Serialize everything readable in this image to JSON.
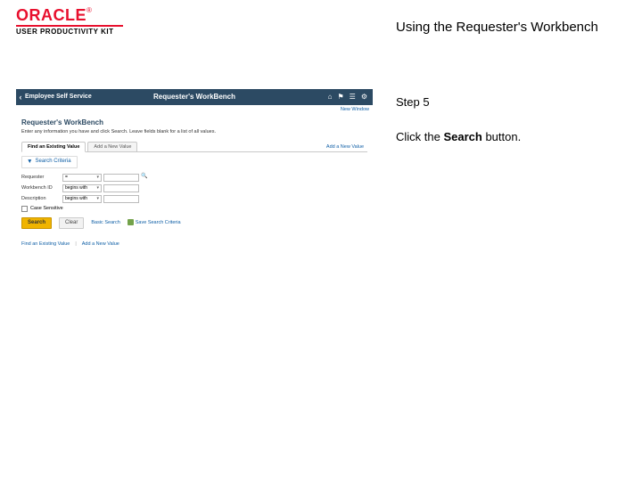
{
  "brand": {
    "logo_text": "ORACLE",
    "tm": "®",
    "subtitle": "USER PRODUCTIVITY KIT"
  },
  "doc_title": "Using the Requester's Workbench",
  "step_label": "Step 5",
  "instruction_prefix": "Click the ",
  "instruction_bold": "Search",
  "instruction_suffix": " button.",
  "app": {
    "back_label": "Employee Self Service",
    "center_title": "Requester's WorkBench",
    "subbar": "New Window",
    "page_title": "Requester's WorkBench",
    "page_desc": "Enter any information you have and click Search. Leave fields blank for a list of all values.",
    "tabs": {
      "active": "Find an Existing Value",
      "inactive": "Add a New Value"
    },
    "add_link": "Add a New Value",
    "criteria_header": "Search Criteria",
    "fields": {
      "requester": {
        "label": "Requester",
        "op": "="
      },
      "workbench": {
        "label": "Workbench ID",
        "op": "begins with"
      },
      "description": {
        "label": "Description",
        "op": "begins with"
      }
    },
    "checkbox_label": "Case Sensitive",
    "buttons": {
      "search": "Search",
      "clear": "Clear",
      "basic": "Basic Search",
      "save": "Save Search Criteria"
    },
    "footer": {
      "find": "Find an Existing Value",
      "add": "Add a New Value"
    }
  }
}
